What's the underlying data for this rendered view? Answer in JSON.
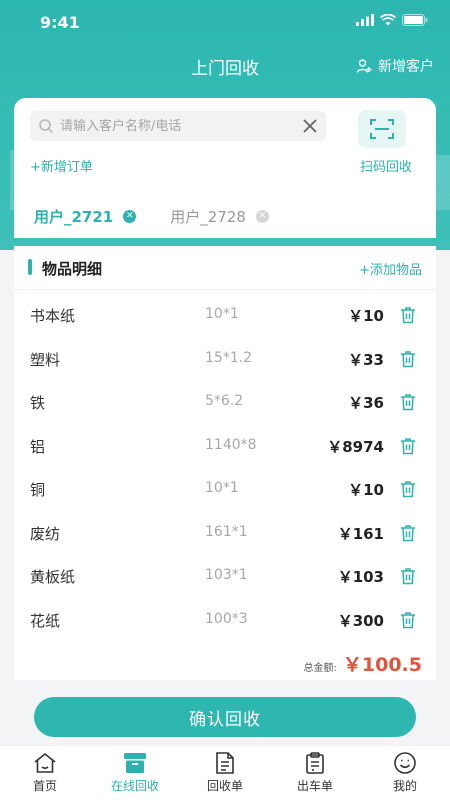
{
  "status_bar": {
    "time": "9:41"
  },
  "header": {
    "title": "上门回收",
    "add_customer": "新增客户"
  },
  "search": {
    "placeholder": "请输入客户名称/电话",
    "new_order": "+新增订单",
    "scan_label": "扫码回收"
  },
  "users": [
    {
      "label": "用户_2721",
      "active": true
    },
    {
      "label": "用户_2728",
      "active": false
    }
  ],
  "items_section": {
    "title": "物品明细",
    "add_item": "+添加物品",
    "rows": [
      {
        "name": "书本纸",
        "spec": "10*1",
        "price": "￥10"
      },
      {
        "name": "塑料",
        "spec": "15*1.2",
        "price": "￥33"
      },
      {
        "name": "铁",
        "spec": "5*6.2",
        "price": "￥36"
      },
      {
        "name": "铝",
        "spec": "1140*8",
        "price": "￥8974"
      },
      {
        "name": "铜",
        "spec": "10*1",
        "price": "￥10"
      },
      {
        "name": "废纺",
        "spec": "161*1",
        "price": "￥161"
      },
      {
        "name": "黄板纸",
        "spec": "103*1",
        "price": "￥103"
      },
      {
        "name": "花纸",
        "spec": "100*3",
        "price": "￥300"
      }
    ],
    "total_label": "总金额:",
    "total_value": "￥100.5"
  },
  "confirm_label": "确认回收",
  "tabbar": [
    {
      "label": "首页",
      "icon": "home-icon",
      "active": false
    },
    {
      "label": "在线回收",
      "icon": "box-icon",
      "active": true
    },
    {
      "label": "回收单",
      "icon": "document-icon",
      "active": false
    },
    {
      "label": "出车单",
      "icon": "clipboard-icon",
      "active": false
    },
    {
      "label": "我的",
      "icon": "smile-icon",
      "active": false
    }
  ],
  "colors": {
    "accent": "#2eb2ad",
    "price_total": "#e2533a"
  }
}
